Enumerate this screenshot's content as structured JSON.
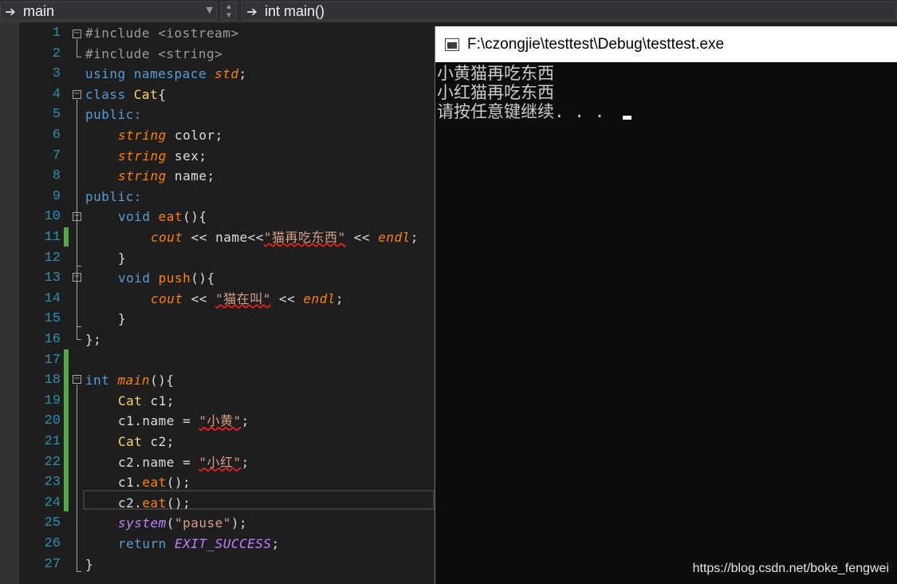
{
  "navbar": {
    "scope": "main",
    "function": "int main()"
  },
  "editor": {
    "line_numbers": [
      "1",
      "2",
      "3",
      "4",
      "5",
      "6",
      "7",
      "8",
      "9",
      "10",
      "11",
      "12",
      "13",
      "14",
      "15",
      "16",
      "17",
      "18",
      "19",
      "20",
      "21",
      "22",
      "23",
      "24",
      "25",
      "26",
      "27"
    ],
    "lines": {
      "l1": {
        "a": "#include ",
        "b": "<iostream>"
      },
      "l2": {
        "a": "#include ",
        "b": "<string>"
      },
      "l3": {
        "a": "using namespace ",
        "b": "std",
        "c": ";"
      },
      "l4": {
        "a": "class ",
        "b": "Cat",
        "c": "{"
      },
      "l5": {
        "a": "public:"
      },
      "l6": {
        "a": "string",
        "b": " color;"
      },
      "l7": {
        "a": "string",
        "b": " sex;"
      },
      "l8": {
        "a": "string",
        "b": " name;"
      },
      "l9": {
        "a": "public:"
      },
      "l10": {
        "a": "void ",
        "b": "eat",
        "c": "(){"
      },
      "l11": {
        "a": "cout",
        "b": " << name<<",
        "c": "\"猫再吃东西\"",
        "d": " << ",
        "e": "endl",
        "f": ";"
      },
      "l12": {
        "a": "}"
      },
      "l13": {
        "a": "void ",
        "b": "push",
        "c": "(){"
      },
      "l14": {
        "a": "cout",
        "b": " << ",
        "c": "\"猫在叫\"",
        "d": " << ",
        "e": "endl",
        "f": ";"
      },
      "l15": {
        "a": "}"
      },
      "l16": {
        "a": "};"
      },
      "l18": {
        "a": "int ",
        "b": "main",
        "c": "(){"
      },
      "l19": {
        "a": "Cat",
        "b": " c1;"
      },
      "l20": {
        "a": "c1.name = ",
        "b": "\"小黄\"",
        "c": ";"
      },
      "l21": {
        "a": "Cat",
        "b": " c2;"
      },
      "l22": {
        "a": "c2.name = ",
        "b": "\"小红\"",
        "c": ";"
      },
      "l23": {
        "a": "c1.",
        "b": "eat",
        "c": "();"
      },
      "l24": {
        "a": "c2.",
        "b": "eat",
        "c": "();"
      },
      "l25": {
        "a": "system",
        "b": "(",
        "c": "\"pause\"",
        "d": ");"
      },
      "l26": {
        "a": "return ",
        "b": "EXIT_SUCCESS",
        "c": ";"
      },
      "l27": {
        "a": "}"
      }
    }
  },
  "console": {
    "title": "F:\\czongjie\\testtest\\Debug\\testtest.exe",
    "lines": [
      "小黄猫再吃东西",
      "小红猫再吃东西",
      "请按任意键继续. . . "
    ]
  },
  "watermark": "https://blog.csdn.net/boke_fengwei"
}
